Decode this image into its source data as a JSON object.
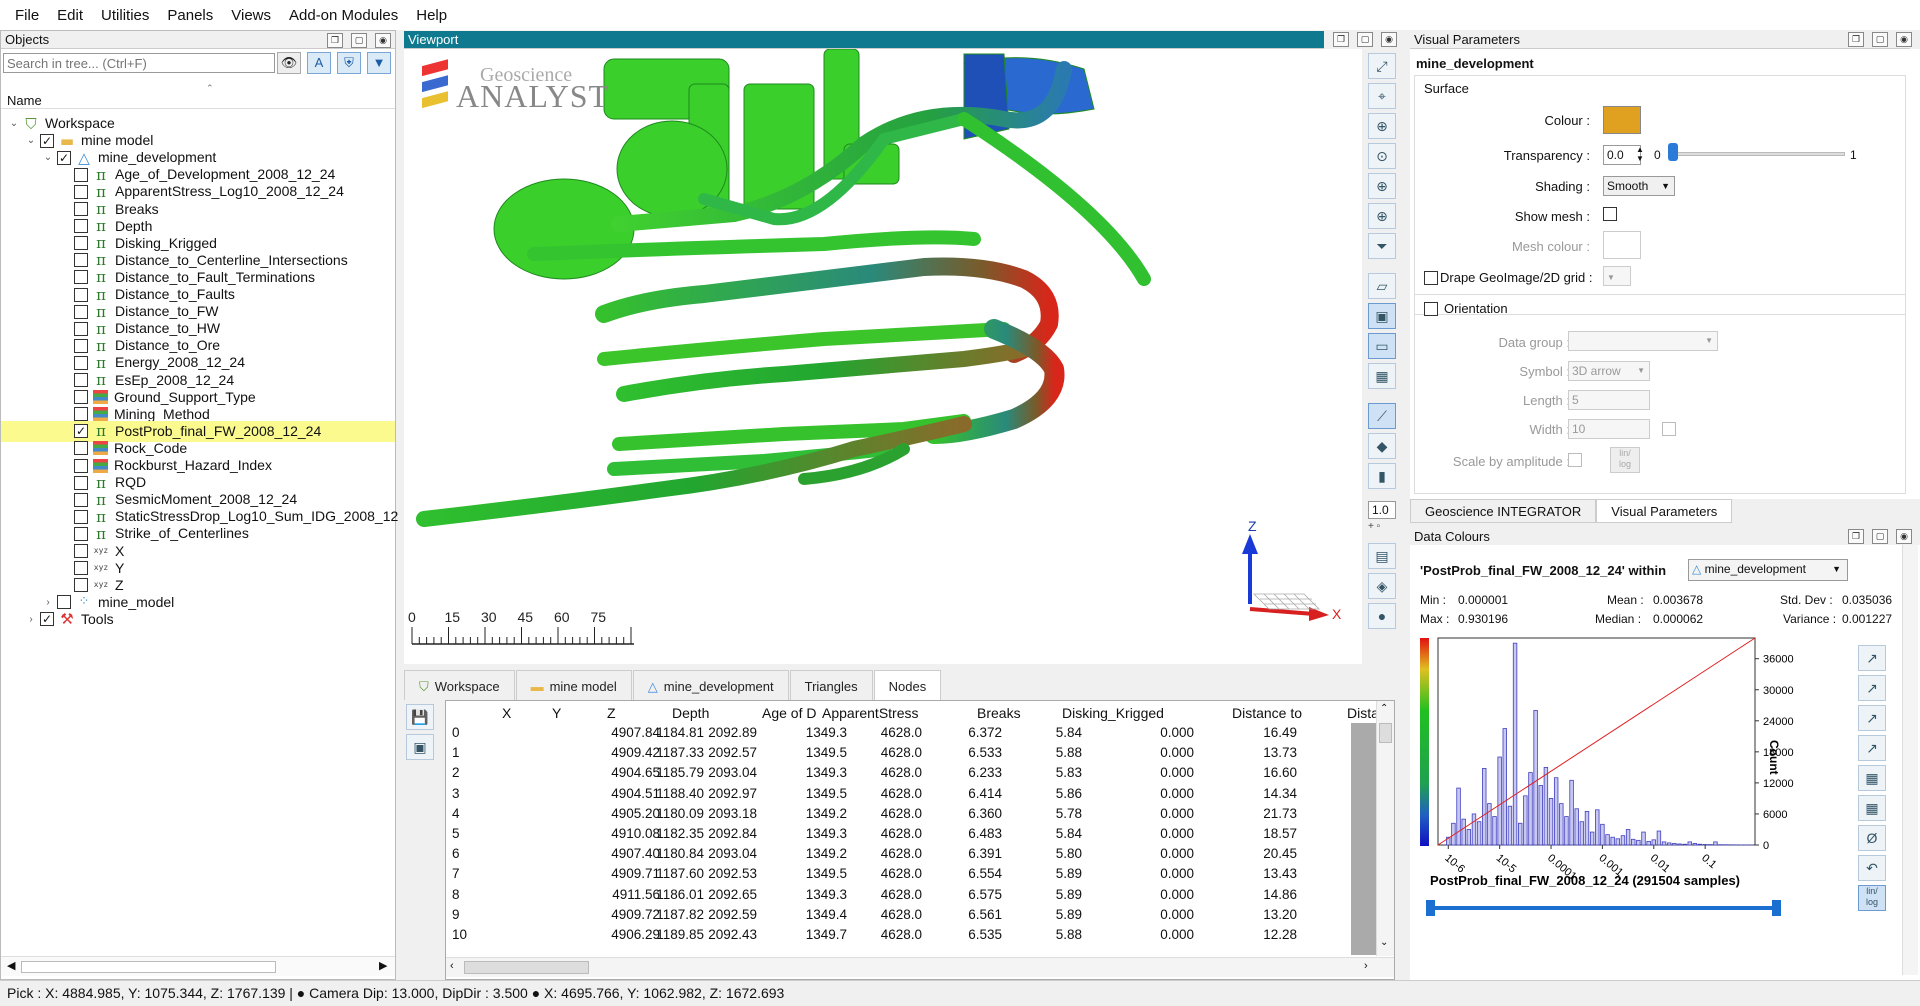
{
  "menu": [
    "File",
    "Edit",
    "Utilities",
    "Panels",
    "Views",
    "Add-on Modules",
    "Help"
  ],
  "objects_panel": {
    "title": "Objects",
    "search_placeholder": "Search in tree... (Ctrl+F)",
    "column_header": "Name",
    "tree": [
      {
        "label": "Workspace",
        "level": 0,
        "icon": "workspace-icon",
        "expand": "open",
        "checkbox": "none"
      },
      {
        "label": "mine model",
        "level": 1,
        "icon": "folder-icon",
        "expand": "open",
        "checkbox": "checked"
      },
      {
        "label": "mine_development",
        "level": 2,
        "icon": "surface-icon",
        "expand": "open",
        "checkbox": "checked"
      },
      {
        "label": "Age_of_Development_2008_12_24",
        "level": 3,
        "icon": "pi-icon",
        "checkbox": "unchecked"
      },
      {
        "label": "ApparentStress_Log10_2008_12_24",
        "level": 3,
        "icon": "pi-icon",
        "checkbox": "unchecked"
      },
      {
        "label": "Breaks",
        "level": 3,
        "icon": "pi-icon",
        "checkbox": "unchecked"
      },
      {
        "label": "Depth",
        "level": 3,
        "icon": "pi-icon",
        "checkbox": "unchecked"
      },
      {
        "label": "Disking_Krigged",
        "level": 3,
        "icon": "pi-icon",
        "checkbox": "unchecked"
      },
      {
        "label": "Distance_to_Centerline_Intersections",
        "level": 3,
        "icon": "pi-icon",
        "checkbox": "unchecked"
      },
      {
        "label": "Distance_to_Fault_Terminations",
        "level": 3,
        "icon": "pi-icon",
        "checkbox": "unchecked"
      },
      {
        "label": "Distance_to_Faults",
        "level": 3,
        "icon": "pi-icon",
        "checkbox": "unchecked"
      },
      {
        "label": "Distance_to_FW",
        "level": 3,
        "icon": "pi-icon",
        "checkbox": "unchecked"
      },
      {
        "label": "Distance_to_HW",
        "level": 3,
        "icon": "pi-icon",
        "checkbox": "unchecked"
      },
      {
        "label": "Distance_to_Ore",
        "level": 3,
        "icon": "pi-icon",
        "checkbox": "unchecked"
      },
      {
        "label": "Energy_2008_12_24",
        "level": 3,
        "icon": "pi-icon",
        "checkbox": "unchecked"
      },
      {
        "label": "EsEp_2008_12_24",
        "level": 3,
        "icon": "pi-icon",
        "checkbox": "unchecked"
      },
      {
        "label": "Ground_Support_Type",
        "level": 3,
        "icon": "referenced-data-icon",
        "checkbox": "unchecked"
      },
      {
        "label": "Mining_Method",
        "level": 3,
        "icon": "referenced-data-icon",
        "checkbox": "unchecked"
      },
      {
        "label": "PostProb_final_FW_2008_12_24",
        "level": 3,
        "icon": "pi-icon",
        "checkbox": "checked",
        "selected": true
      },
      {
        "label": "Rock_Code",
        "level": 3,
        "icon": "referenced-data-icon",
        "checkbox": "unchecked"
      },
      {
        "label": "Rockburst_Hazard_Index",
        "level": 3,
        "icon": "referenced-data-icon",
        "checkbox": "unchecked"
      },
      {
        "label": "RQD",
        "level": 3,
        "icon": "pi-icon",
        "checkbox": "unchecked"
      },
      {
        "label": "SesmicMoment_2008_12_24",
        "level": 3,
        "icon": "pi-icon",
        "checkbox": "unchecked"
      },
      {
        "label": "StaticStressDrop_Log10_Sum_IDG_2008_12",
        "level": 3,
        "icon": "pi-icon",
        "checkbox": "unchecked"
      },
      {
        "label": "Strike_of_Centerlines",
        "level": 3,
        "icon": "pi-icon",
        "checkbox": "unchecked"
      },
      {
        "label": "X",
        "level": 3,
        "icon": "xyz-icon",
        "checkbox": "unchecked"
      },
      {
        "label": "Y",
        "level": 3,
        "icon": "xyz-icon",
        "checkbox": "unchecked"
      },
      {
        "label": "Z",
        "level": 3,
        "icon": "xyz-icon",
        "checkbox": "unchecked"
      },
      {
        "label": "mine_model",
        "level": 2,
        "icon": "points-icon",
        "expand": "closed",
        "checkbox": "unchecked"
      },
      {
        "label": "Tools",
        "level": 1,
        "icon": "tools-icon",
        "expand": "closed",
        "checkbox": "checked"
      }
    ]
  },
  "viewport": {
    "title": "Viewport",
    "logo_line1": "Geoscience",
    "logo_line2": "ANALYST",
    "scale_ticks": [
      "0",
      "15",
      "30",
      "45",
      "60",
      "75"
    ],
    "axis_z": "Z",
    "axis_x": "X",
    "axis_y": "Y",
    "zoom_value": "1.0"
  },
  "bottom_tabs": [
    "Workspace",
    "mine model",
    "mine_development",
    "Triangles",
    "Nodes"
  ],
  "active_bottom_tab": 4,
  "table": {
    "columns": [
      "X",
      "Y",
      "Z",
      "Depth",
      "Age of D",
      "ApparentStress",
      "Breaks",
      "Disking_Krigged",
      "Distance to",
      "Dista"
    ],
    "rows": [
      [
        "0",
        "4907.84",
        "1184.81",
        "2092.89",
        "1349.3",
        "4628.0",
        "6.372",
        "5.84",
        "0.000",
        "16.49"
      ],
      [
        "1",
        "4909.42",
        "1187.33",
        "2092.57",
        "1349.5",
        "4628.0",
        "6.533",
        "5.88",
        "0.000",
        "13.73"
      ],
      [
        "2",
        "4904.65",
        "1185.79",
        "2093.04",
        "1349.3",
        "4628.0",
        "6.233",
        "5.83",
        "0.000",
        "16.60"
      ],
      [
        "3",
        "4904.51",
        "1188.40",
        "2092.97",
        "1349.5",
        "4628.0",
        "6.414",
        "5.86",
        "0.000",
        "14.34"
      ],
      [
        "4",
        "4905.20",
        "1180.09",
        "2093.18",
        "1349.2",
        "4628.0",
        "6.360",
        "5.78",
        "0.000",
        "21.73"
      ],
      [
        "5",
        "4910.08",
        "1182.35",
        "2092.84",
        "1349.3",
        "4628.0",
        "6.483",
        "5.84",
        "0.000",
        "18.57"
      ],
      [
        "6",
        "4907.40",
        "1180.84",
        "2093.04",
        "1349.2",
        "4628.0",
        "6.391",
        "5.80",
        "0.000",
        "20.45"
      ],
      [
        "7",
        "4909.71",
        "1187.60",
        "2092.53",
        "1349.5",
        "4628.0",
        "6.554",
        "5.89",
        "0.000",
        "13.43"
      ],
      [
        "8",
        "4911.56",
        "1186.01",
        "2092.65",
        "1349.3",
        "4628.0",
        "6.575",
        "5.89",
        "0.000",
        "14.86"
      ],
      [
        "9",
        "4909.72",
        "1187.82",
        "2092.59",
        "1349.4",
        "4628.0",
        "6.561",
        "5.89",
        "0.000",
        "13.20"
      ],
      [
        "10",
        "4906.29",
        "1189.85",
        "2092.43",
        "1349.7",
        "4628.0",
        "6.535",
        "5.88",
        "0.000",
        "12.28"
      ]
    ]
  },
  "visual_params": {
    "title": "Visual Parameters",
    "object_name": "mine_development",
    "section": "Surface",
    "colour_label": "Colour :",
    "colour_value": "#e0a020",
    "transparency_label": "Transparency :",
    "transparency_value": "0.0",
    "transparency_min": "0",
    "transparency_max": "1",
    "shading_label": "Shading :",
    "shading_value": "Smooth",
    "show_mesh_label": "Show mesh :",
    "mesh_colour_label": "Mesh colour :",
    "drape_label": "Drape GeoImage/2D grid :",
    "orientation_label": "Orientation",
    "data_group_label": "Data group :",
    "symbol_label": "Symbol :",
    "symbol_value": "3D arrow",
    "length_label": "Length :",
    "length_value": "5",
    "width_label": "Width :",
    "width_value": "10",
    "scale_amp_label": "Scale by amplitude :",
    "tabs": [
      "Geoscience INTEGRATOR",
      "Visual Parameters"
    ]
  },
  "data_colours": {
    "title": "Data Colours",
    "heading": "'PostProb_final_FW_2008_12_24' within",
    "within_value": "mine_development",
    "min_label": "Min :",
    "min": "0.000001",
    "mean_label": "Mean :",
    "mean": "0.003678",
    "std_label": "Std. Dev :",
    "std": "0.035036",
    "max_label": "Max :",
    "max": "0.930196",
    "median_label": "Median :",
    "median": "0.000062",
    "variance_label": "Variance :",
    "variance": "0.001227",
    "footer": "PostProb_final_FW_2008_12_24 (291504 samples)",
    "count_label": "Count"
  },
  "chart_data": {
    "type": "bar",
    "title": "",
    "xlabel": "",
    "ylabel": "Count",
    "log_x": true,
    "x_tick_labels": [
      "10-6",
      "10-5",
      "0.0001",
      "0.001",
      "0.01",
      "0.1"
    ],
    "y_ticks": [
      0,
      6000,
      12000,
      18000,
      24000,
      30000,
      36000
    ],
    "ylim": [
      0,
      40000
    ],
    "xlim_log10": [
      -6.2,
      -0.03
    ],
    "bins_log10_centers": [
      -6.0,
      -5.9,
      -5.8,
      -5.7,
      -5.6,
      -5.5,
      -5.4,
      -5.3,
      -5.2,
      -5.1,
      -5.0,
      -4.9,
      -4.8,
      -4.7,
      -4.6,
      -4.5,
      -4.4,
      -4.3,
      -4.2,
      -4.1,
      -4.0,
      -3.9,
      -3.8,
      -3.7,
      -3.6,
      -3.5,
      -3.4,
      -3.3,
      -3.2,
      -3.1,
      -3.0,
      -2.9,
      -2.8,
      -2.7,
      -2.6,
      -2.5,
      -2.4,
      -2.3,
      -2.2,
      -2.1,
      -2.0,
      -1.9,
      -1.8,
      -1.7,
      -1.6,
      -1.5,
      -1.4,
      -1.3,
      -1.2,
      -1.1,
      -1.0,
      -0.9,
      -0.8,
      -0.7,
      -0.6,
      -0.5,
      -0.4,
      -0.3,
      -0.2,
      -0.1
    ],
    "counts": [
      1500,
      4200,
      11000,
      5000,
      3000,
      6000,
      4500,
      14800,
      8000,
      5500,
      17000,
      22500,
      7500,
      39000,
      4200,
      9500,
      14000,
      26000,
      11500,
      15000,
      9000,
      13000,
      8000,
      5500,
      12500,
      7000,
      4500,
      6500,
      2500,
      6800,
      4000,
      2000,
      1500,
      1200,
      1800,
      3000,
      1100,
      900,
      2500,
      700,
      1000,
      2700,
      600,
      400,
      300,
      200,
      150,
      600,
      300,
      150,
      100,
      80,
      600,
      60,
      50,
      40,
      30,
      20,
      10,
      5
    ],
    "cdf_line": "diagonal"
  },
  "status": "Pick : X: 4884.985, Y: 1075.344, Z: 1767.139 |   ●  Camera Dip: 13.000, DipDir : 3.500  ●  X: 4695.766, Y: 1062.982, Z: 1672.693",
  "colors": {
    "header_teal": "#0f7a8f",
    "selected": "#fafa8f",
    "accent_blue": "#1a6fd0"
  }
}
